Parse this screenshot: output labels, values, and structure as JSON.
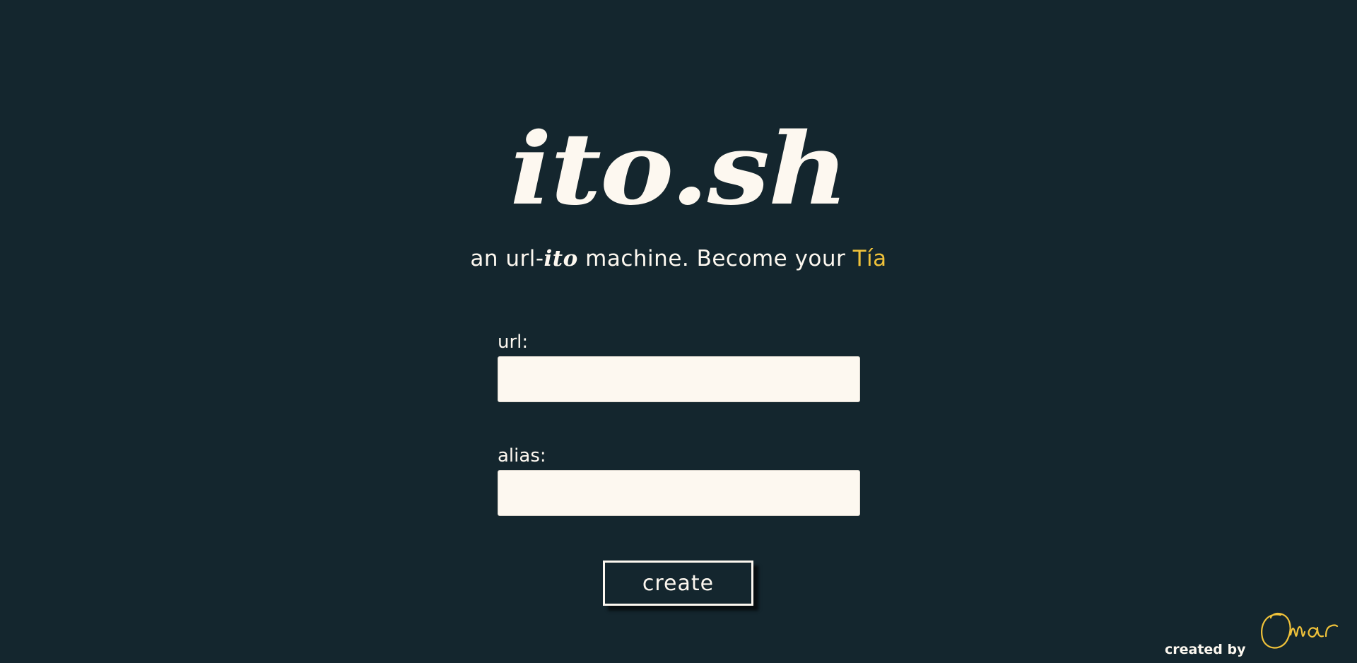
{
  "header": {
    "logo_text": "ito.sh",
    "tagline": {
      "prefix": "an url-",
      "emphasis": "ito",
      "middle": " machine. Become your ",
      "highlight": "Tía"
    }
  },
  "form": {
    "url": {
      "label": "url:",
      "value": "",
      "placeholder": ""
    },
    "alias": {
      "label": "alias:",
      "value": "",
      "placeholder": ""
    },
    "submit_label": "create"
  },
  "footer": {
    "credit_text": "created by",
    "signature_text": "Omar"
  },
  "colors": {
    "background": "#14262e",
    "foreground": "#fdf8f0",
    "accent": "#f0c23a"
  }
}
